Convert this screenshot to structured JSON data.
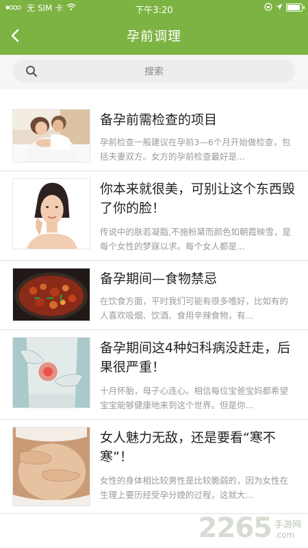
{
  "status_bar": {
    "carrier": "无 SIM 卡",
    "time": "下午3:20"
  },
  "header": {
    "title": "孕前调理"
  },
  "search": {
    "placeholder": "搜索"
  },
  "articles": [
    {
      "title": "备孕前需检查的项目",
      "desc": "孕前检查一般建议在孕前3—6个月开始做检查，包括夫妻双方。女方的孕前检查最好是..."
    },
    {
      "title": "你本来就很美，可别让这个东西毁了你的脸！",
      "desc": "传说中的肤若凝脂,不施粉黛而颜色如朝霞映雪，是每个女性的梦寐以求。每个女人都是..."
    },
    {
      "title": "备孕期间—食物禁忌",
      "desc": "在饮食方面，平时我们可能有很多嗜好，比如有的人喜欢吸烟、饮酒、食用辛辣食物，有..."
    },
    {
      "title": "备孕期间这4种妇科病没赶走，后果很严重！",
      "desc": "十月怀胎，母子心连心。相信每位宝爸宝妈都希望宝宝能够健康地来到这个世界。但是你..."
    },
    {
      "title": "女人魅力无敌，还是要看“寒不寒”！",
      "desc": "女性的身体相比较男性是比较脆弱的，因为女性在生理上要历经受孕分娩的过程，这就大..."
    }
  ],
  "watermark": {
    "number": "2265",
    "site": "手游网",
    "domain": ".com"
  }
}
